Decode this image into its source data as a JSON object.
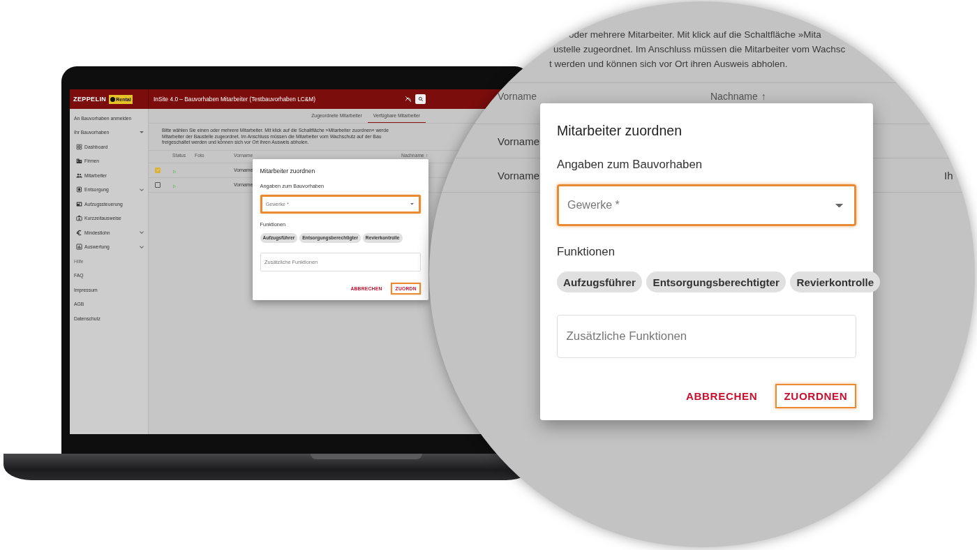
{
  "laptop": {
    "brand": "ZEPPELIN",
    "brand_badge": "Rental",
    "title": "InSite 4.0 – Bauvorhaben Mitarbeiter (Testbauvorhaben LC&M)",
    "sidebar": [
      {
        "kind": "link",
        "label": "An Bauvorhaben anmelden"
      },
      {
        "kind": "group",
        "label": "Ihr Bauvorhaben",
        "expanded": true
      },
      {
        "kind": "nav",
        "label": "Dashboard"
      },
      {
        "kind": "nav",
        "label": "Firmen"
      },
      {
        "kind": "nav",
        "label": "Mitarbeiter"
      },
      {
        "kind": "nav",
        "label": "Entsorgung",
        "expanded": false
      },
      {
        "kind": "nav",
        "label": "Aufzugssteuerung"
      },
      {
        "kind": "nav",
        "label": "Kurzzeitausweise"
      },
      {
        "kind": "nav",
        "label": "Mindestlohn",
        "expanded": false
      },
      {
        "kind": "nav",
        "label": "Auswertung",
        "expanded": false
      },
      {
        "kind": "section",
        "label": "Hilfe"
      },
      {
        "kind": "link",
        "label": "FAQ"
      },
      {
        "kind": "link",
        "label": "Impressum"
      },
      {
        "kind": "link",
        "label": "AGB"
      },
      {
        "kind": "link",
        "label": "Datenschutz"
      }
    ],
    "tabs": [
      {
        "label": "Zugeordnete Mitarbeiter",
        "selected": false
      },
      {
        "label": "Verfügbare Mitarbeiter",
        "selected": true
      }
    ],
    "description": [
      "Bitte wählen Sie einen oder mehrere Mitarbeiter. Mit klick auf die Schaltfläche »Mitarbeiter zuordnen« werde",
      "Mitarbeiter der Baustelle zugeordnet. Im Anschluss müssen die Mitarbeiter vom Wachschutz auf der Bau",
      "freigeschaltet werden und können sich vor Ort ihren Ausweis abholen."
    ],
    "table": {
      "columns": [
        {
          "label": "Status"
        },
        {
          "label": "Foto"
        },
        {
          "label": "Vorname"
        },
        {
          "label": "Nachname",
          "sort_indicator": "↑"
        }
      ],
      "rows": [
        {
          "checked": true,
          "vorname": "Vorname"
        },
        {
          "checked": false,
          "vorname": "Vorname"
        }
      ]
    },
    "dialog": {
      "title": "Mitarbeiter zuordnen",
      "section": "Angaben zum Bauvorhaben",
      "select": {
        "placeholder": "Gewerke *",
        "highlighted": true
      },
      "functions_label": "Funktionen",
      "chips": [
        "Aufzugsführer",
        "Entsorgungsberechtigter",
        "Revierkontrolle"
      ],
      "extra": {
        "placeholder": "Zusätzliche Funktionen"
      },
      "buttons": [
        {
          "label": "ABBRECHEN",
          "highlighted": false
        },
        {
          "label": "ZUORDN",
          "highlighted": true
        }
      ]
    }
  },
  "magnifier": {
    "description": [
      "oder mehrere Mitarbeiter. Mit klick auf die Schaltfläche »Mita",
      "ustelle zugeordnet. Im Anschluss müssen die Mitarbeiter vom Wachsc",
      "t werden und können sich vor Ort ihren Ausweis abholen."
    ],
    "table": {
      "columns": [
        {
          "label": "Vorname"
        },
        {
          "label": "Nachname",
          "sort_indicator": "↑"
        }
      ],
      "rows": [
        {
          "vorname": "Vorname"
        },
        {
          "vorname": "Vorname",
          "column_3": "Ih"
        }
      ]
    },
    "dialog": {
      "title": "Mitarbeiter zuordnen",
      "section": "Angaben zum Bauvorhaben",
      "select": {
        "placeholder": "Gewerke *",
        "highlighted": true
      },
      "functions_label": "Funktionen",
      "chips": [
        "Aufzugsführer",
        "Entsorgungsberechtigter",
        "Revierkontrolle"
      ],
      "extra": {
        "placeholder": "Zusätzliche Funktionen"
      },
      "buttons": [
        {
          "label": "ABBRECHEN",
          "highlighted": false
        },
        {
          "label": "ZUORDNEN",
          "highlighted": true
        }
      ]
    }
  }
}
